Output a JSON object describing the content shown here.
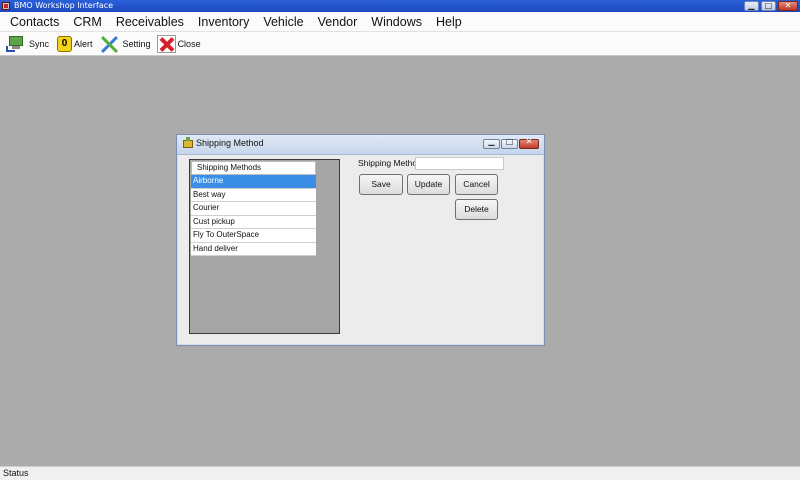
{
  "window": {
    "title": "BMO Workshop Interface",
    "controls": {
      "minimize": "▁",
      "maximize": "□",
      "close": "✕"
    }
  },
  "menu": [
    "Contacts",
    "CRM",
    "Receivables",
    "Inventory",
    "Vehicle",
    "Vendor",
    "Windows",
    "Help"
  ],
  "toolbar": {
    "sync": {
      "label": "Sync",
      "icon": "sync-icon"
    },
    "alert": {
      "label": "Alert",
      "icon": "alert-icon",
      "badge": "0"
    },
    "setting": {
      "label": "Setting",
      "icon": "setting-icon"
    },
    "close": {
      "label": "Close",
      "icon": "close-icon"
    }
  },
  "dialog": {
    "title": "Shipping Method",
    "controls": {
      "minimize": "▁",
      "maximize": "□",
      "close": "✕"
    },
    "list": {
      "header": "Shipping Methods",
      "items": [
        "Airborne",
        "Best way",
        "Courier",
        "Cust pickup",
        "Fly To OuterSpace",
        "Hand deliver"
      ],
      "selected_index": 0
    },
    "field": {
      "label": "Shipping Method",
      "value": ""
    },
    "buttons": {
      "save": "Save",
      "update": "Update",
      "cancel": "Cancel",
      "delete": "Delete"
    }
  },
  "status": {
    "text": "Status"
  },
  "colors": {
    "titlebar": "#2a5fd8",
    "selection": "#3a8ee6",
    "workspace": "#ababab"
  }
}
